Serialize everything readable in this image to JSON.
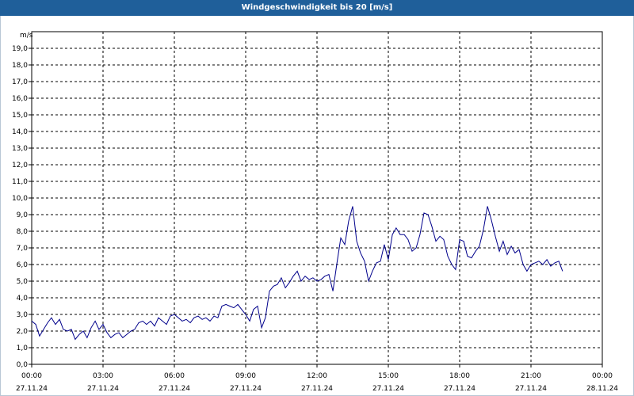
{
  "window": {
    "title": "Windgeschwindigkeit bis 20 [m/s]"
  },
  "chart_data": {
    "type": "line",
    "title": "Windgeschwindigkeit bis 20 [m/s]",
    "ylabel": "m/s",
    "ylim": [
      0,
      20
    ],
    "xlim_hours": [
      0,
      24
    ],
    "grid": true,
    "colors": {
      "line": "#00008b",
      "grid": "#000000",
      "title_bg": "#1f5f9a"
    },
    "y_ticks": [
      "0,0",
      "1,0",
      "2,0",
      "3,0",
      "4,0",
      "5,0",
      "6,0",
      "7,0",
      "8,0",
      "9,0",
      "10,0",
      "11,0",
      "12,0",
      "13,0",
      "14,0",
      "15,0",
      "16,0",
      "17,0",
      "18,0",
      "19,0"
    ],
    "x_ticks": [
      {
        "time": "00:00",
        "date": "27.11.24"
      },
      {
        "time": "03:00",
        "date": "27.11.24"
      },
      {
        "time": "06:00",
        "date": "27.11.24"
      },
      {
        "time": "09:00",
        "date": "27.11.24"
      },
      {
        "time": "12:00",
        "date": "27.11.24"
      },
      {
        "time": "15:00",
        "date": "27.11.24"
      },
      {
        "time": "18:00",
        "date": "27.11.24"
      },
      {
        "time": "21:00",
        "date": "27.11.24"
      },
      {
        "time": "00:00",
        "date": "28.11.24"
      }
    ],
    "series": [
      {
        "x_hours": [
          0.0,
          0.17,
          0.33,
          0.5,
          0.67,
          0.83,
          1.0,
          1.17,
          1.33,
          1.5,
          1.67,
          1.83,
          2.0,
          2.17,
          2.33,
          2.5,
          2.67,
          2.83,
          3.0,
          3.17,
          3.33,
          3.5,
          3.67,
          3.83,
          4.0,
          4.17,
          4.33,
          4.5,
          4.67,
          4.83,
          5.0,
          5.17,
          5.33,
          5.5,
          5.67,
          5.83,
          6.0,
          6.17,
          6.33,
          6.5,
          6.67,
          6.83,
          7.0,
          7.17,
          7.33,
          7.5,
          7.67,
          7.83,
          8.0,
          8.17,
          8.33,
          8.5,
          8.67,
          8.83,
          9.0,
          9.17,
          9.33,
          9.5,
          9.67,
          9.83,
          10.0,
          10.17,
          10.33,
          10.5,
          10.67,
          10.83,
          11.0,
          11.17,
          11.33,
          11.5,
          11.67,
          11.83,
          12.0,
          12.17,
          12.33,
          12.5,
          12.67,
          12.83,
          13.0,
          13.17,
          13.33,
          13.5,
          13.67,
          13.83,
          14.0,
          14.17,
          14.33,
          14.5,
          14.67,
          14.83,
          15.0,
          15.17,
          15.33,
          15.5,
          15.67,
          15.83,
          16.0,
          16.17,
          16.33,
          16.5,
          16.67,
          16.83,
          17.0,
          17.17,
          17.33,
          17.5,
          17.67,
          17.83,
          18.0,
          18.17,
          18.33,
          18.5,
          18.67,
          18.83,
          19.0,
          19.17,
          19.33,
          19.5,
          19.67,
          19.83,
          20.0,
          20.17,
          20.33,
          20.5,
          20.67,
          20.83,
          21.0,
          21.17,
          21.33,
          21.5,
          21.67,
          21.83,
          22.0,
          22.17,
          22.33,
          22.5,
          22.67,
          22.83,
          23.0,
          23.17,
          23.33,
          23.5,
          23.67,
          23.83,
          24.0
        ],
        "y": [
          2.6,
          2.4,
          1.7,
          2.1,
          2.5,
          2.8,
          2.4,
          2.7,
          2.1,
          2.0,
          2.1,
          1.5,
          1.8,
          2.0,
          1.6,
          2.2,
          2.6,
          2.1,
          2.4,
          1.9,
          1.6,
          1.8,
          1.9,
          1.6,
          1.8,
          2.0,
          2.1,
          2.5,
          2.6,
          2.4,
          2.6,
          2.3,
          2.8,
          2.6,
          2.4,
          2.9,
          3.0,
          2.8,
          2.6,
          2.7,
          2.5,
          2.8,
          2.9,
          2.7,
          2.8,
          2.6,
          2.9,
          2.8,
          3.5,
          3.6,
          3.5,
          3.4,
          3.6,
          3.3,
          3.0,
          2.6,
          3.3,
          3.5,
          2.2,
          2.8,
          4.4,
          4.7,
          4.8,
          5.2,
          4.6,
          4.9,
          5.3,
          5.6,
          5.0,
          5.3,
          5.1,
          5.2,
          5.0,
          5.1,
          5.3,
          5.4,
          4.4,
          6.0,
          7.6,
          7.2,
          8.6,
          9.5,
          7.4,
          6.7,
          6.2,
          5.0,
          5.6,
          6.1,
          6.2,
          7.2,
          6.3,
          7.8,
          8.2,
          7.8,
          7.8,
          7.5,
          6.8,
          7.0,
          7.8,
          9.1,
          9.0,
          8.3,
          7.4,
          7.7,
          7.5,
          6.5,
          6.0,
          5.7,
          7.5,
          7.4,
          6.5,
          6.4,
          6.8,
          7.1,
          8.1,
          9.5,
          8.7,
          7.7,
          6.8,
          7.4,
          6.6,
          7.1,
          6.7,
          6.9,
          6.0,
          5.6,
          6.0,
          6.1,
          6.2,
          6.0,
          6.3,
          5.9,
          6.1,
          6.2,
          5.6
        ]
      }
    ]
  }
}
